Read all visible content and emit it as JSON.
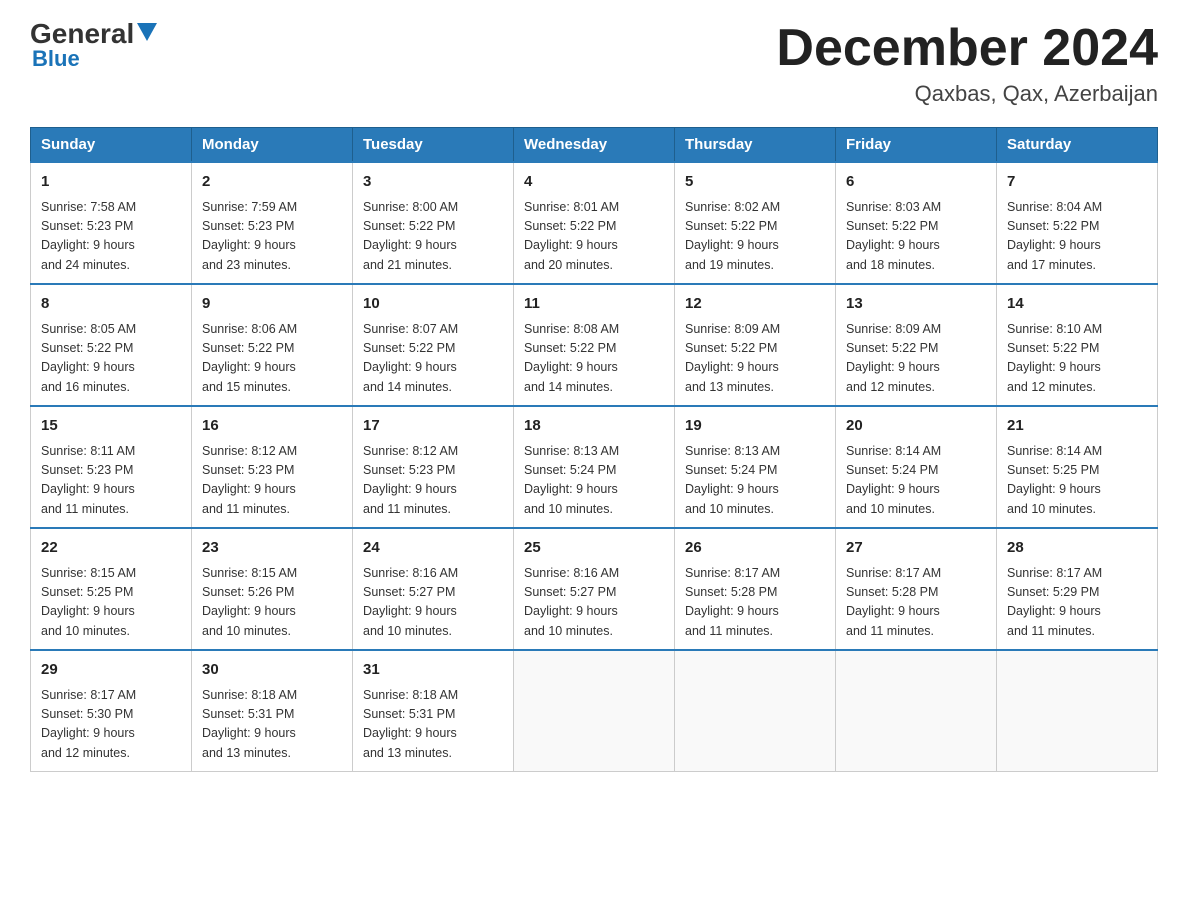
{
  "header": {
    "logo_general": "General",
    "logo_blue": "Blue",
    "month_title": "December 2024",
    "location": "Qaxbas, Qax, Azerbaijan"
  },
  "weekdays": [
    "Sunday",
    "Monday",
    "Tuesday",
    "Wednesday",
    "Thursday",
    "Friday",
    "Saturday"
  ],
  "weeks": [
    [
      {
        "day": "1",
        "sunrise": "7:58 AM",
        "sunset": "5:23 PM",
        "daylight": "9 hours and 24 minutes."
      },
      {
        "day": "2",
        "sunrise": "7:59 AM",
        "sunset": "5:23 PM",
        "daylight": "9 hours and 23 minutes."
      },
      {
        "day": "3",
        "sunrise": "8:00 AM",
        "sunset": "5:22 PM",
        "daylight": "9 hours and 21 minutes."
      },
      {
        "day": "4",
        "sunrise": "8:01 AM",
        "sunset": "5:22 PM",
        "daylight": "9 hours and 20 minutes."
      },
      {
        "day": "5",
        "sunrise": "8:02 AM",
        "sunset": "5:22 PM",
        "daylight": "9 hours and 19 minutes."
      },
      {
        "day": "6",
        "sunrise": "8:03 AM",
        "sunset": "5:22 PM",
        "daylight": "9 hours and 18 minutes."
      },
      {
        "day": "7",
        "sunrise": "8:04 AM",
        "sunset": "5:22 PM",
        "daylight": "9 hours and 17 minutes."
      }
    ],
    [
      {
        "day": "8",
        "sunrise": "8:05 AM",
        "sunset": "5:22 PM",
        "daylight": "9 hours and 16 minutes."
      },
      {
        "day": "9",
        "sunrise": "8:06 AM",
        "sunset": "5:22 PM",
        "daylight": "9 hours and 15 minutes."
      },
      {
        "day": "10",
        "sunrise": "8:07 AM",
        "sunset": "5:22 PM",
        "daylight": "9 hours and 14 minutes."
      },
      {
        "day": "11",
        "sunrise": "8:08 AM",
        "sunset": "5:22 PM",
        "daylight": "9 hours and 14 minutes."
      },
      {
        "day": "12",
        "sunrise": "8:09 AM",
        "sunset": "5:22 PM",
        "daylight": "9 hours and 13 minutes."
      },
      {
        "day": "13",
        "sunrise": "8:09 AM",
        "sunset": "5:22 PM",
        "daylight": "9 hours and 12 minutes."
      },
      {
        "day": "14",
        "sunrise": "8:10 AM",
        "sunset": "5:22 PM",
        "daylight": "9 hours and 12 minutes."
      }
    ],
    [
      {
        "day": "15",
        "sunrise": "8:11 AM",
        "sunset": "5:23 PM",
        "daylight": "9 hours and 11 minutes."
      },
      {
        "day": "16",
        "sunrise": "8:12 AM",
        "sunset": "5:23 PM",
        "daylight": "9 hours and 11 minutes."
      },
      {
        "day": "17",
        "sunrise": "8:12 AM",
        "sunset": "5:23 PM",
        "daylight": "9 hours and 11 minutes."
      },
      {
        "day": "18",
        "sunrise": "8:13 AM",
        "sunset": "5:24 PM",
        "daylight": "9 hours and 10 minutes."
      },
      {
        "day": "19",
        "sunrise": "8:13 AM",
        "sunset": "5:24 PM",
        "daylight": "9 hours and 10 minutes."
      },
      {
        "day": "20",
        "sunrise": "8:14 AM",
        "sunset": "5:24 PM",
        "daylight": "9 hours and 10 minutes."
      },
      {
        "day": "21",
        "sunrise": "8:14 AM",
        "sunset": "5:25 PM",
        "daylight": "9 hours and 10 minutes."
      }
    ],
    [
      {
        "day": "22",
        "sunrise": "8:15 AM",
        "sunset": "5:25 PM",
        "daylight": "9 hours and 10 minutes."
      },
      {
        "day": "23",
        "sunrise": "8:15 AM",
        "sunset": "5:26 PM",
        "daylight": "9 hours and 10 minutes."
      },
      {
        "day": "24",
        "sunrise": "8:16 AM",
        "sunset": "5:27 PM",
        "daylight": "9 hours and 10 minutes."
      },
      {
        "day": "25",
        "sunrise": "8:16 AM",
        "sunset": "5:27 PM",
        "daylight": "9 hours and 10 minutes."
      },
      {
        "day": "26",
        "sunrise": "8:17 AM",
        "sunset": "5:28 PM",
        "daylight": "9 hours and 11 minutes."
      },
      {
        "day": "27",
        "sunrise": "8:17 AM",
        "sunset": "5:28 PM",
        "daylight": "9 hours and 11 minutes."
      },
      {
        "day": "28",
        "sunrise": "8:17 AM",
        "sunset": "5:29 PM",
        "daylight": "9 hours and 11 minutes."
      }
    ],
    [
      {
        "day": "29",
        "sunrise": "8:17 AM",
        "sunset": "5:30 PM",
        "daylight": "9 hours and 12 minutes."
      },
      {
        "day": "30",
        "sunrise": "8:18 AM",
        "sunset": "5:31 PM",
        "daylight": "9 hours and 13 minutes."
      },
      {
        "day": "31",
        "sunrise": "8:18 AM",
        "sunset": "5:31 PM",
        "daylight": "9 hours and 13 minutes."
      },
      null,
      null,
      null,
      null
    ]
  ],
  "labels": {
    "sunrise": "Sunrise:",
    "sunset": "Sunset:",
    "daylight": "Daylight:"
  }
}
